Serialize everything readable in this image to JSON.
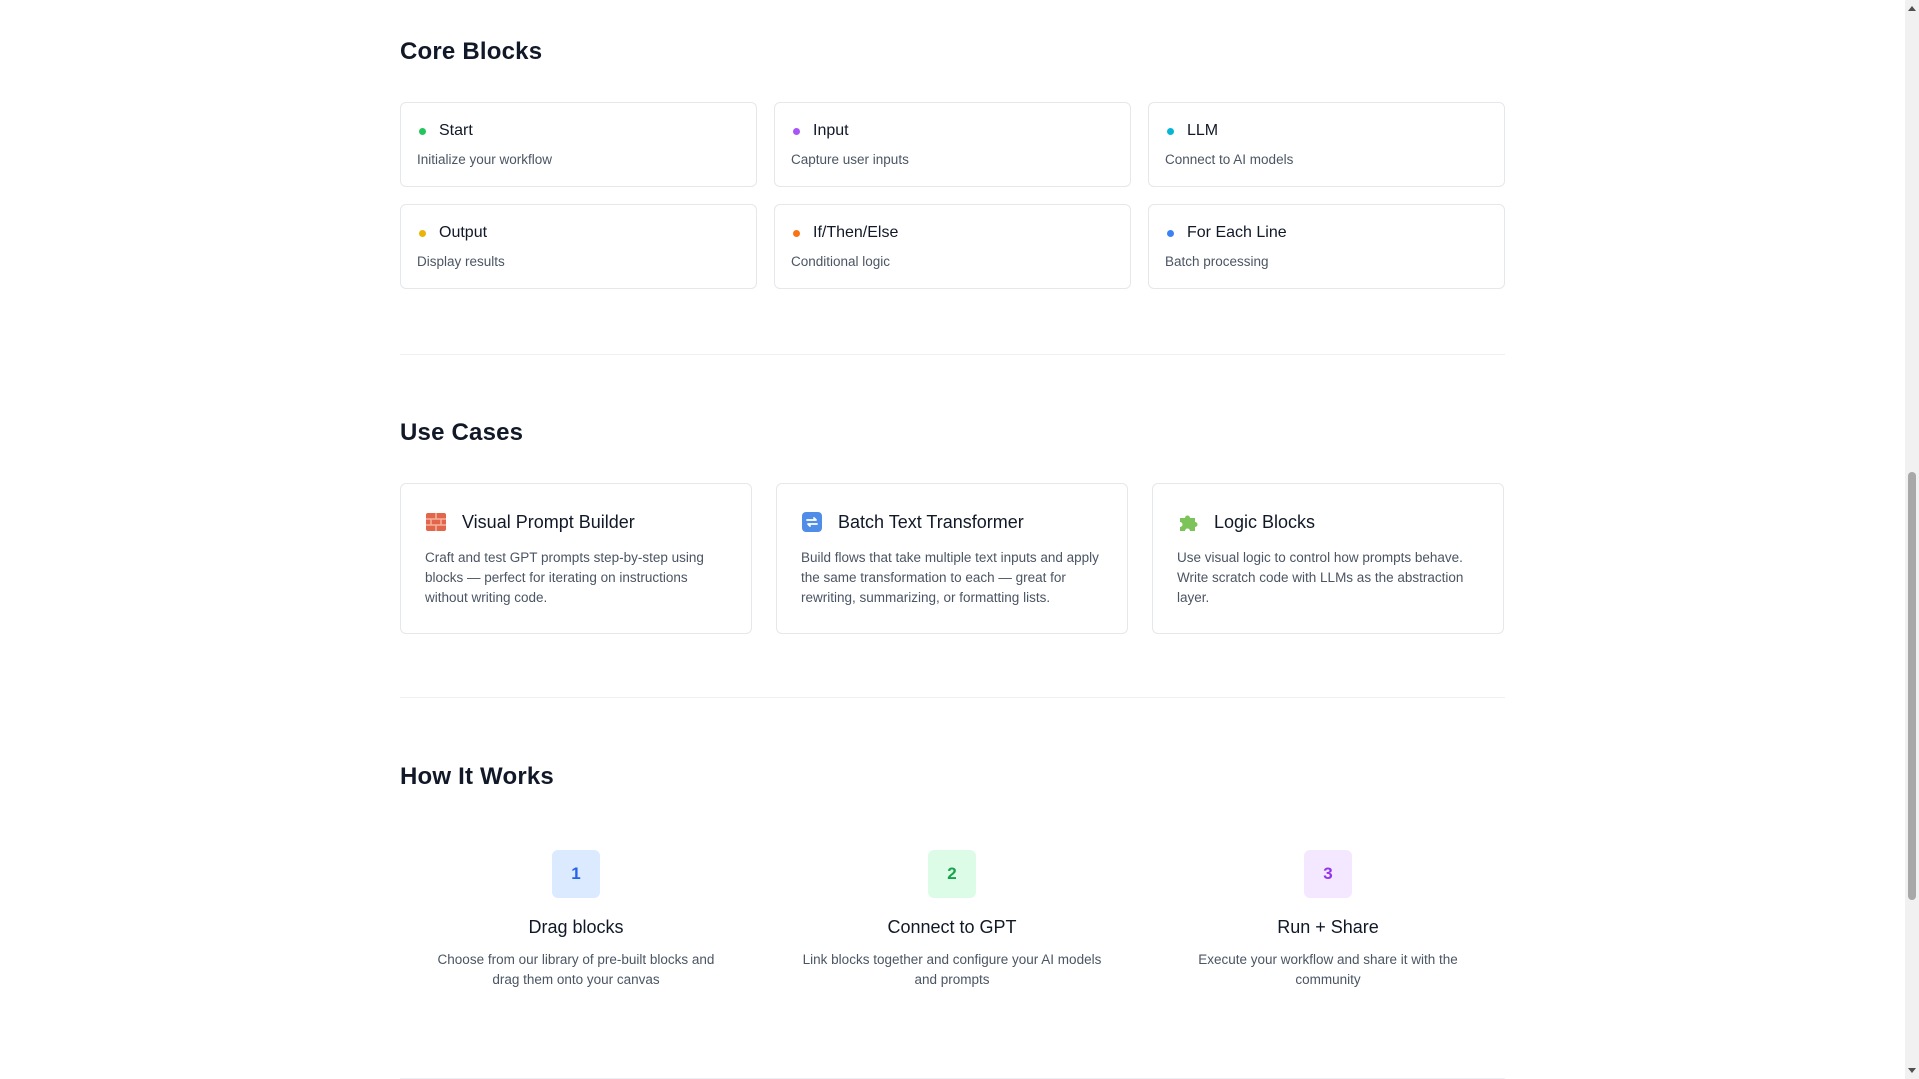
{
  "core": {
    "title": "Core Blocks",
    "blocks": [
      {
        "name": "Start",
        "desc": "Initialize your workflow",
        "color": "#22c55e"
      },
      {
        "name": "Input",
        "desc": "Capture user inputs",
        "color": "#a855f7"
      },
      {
        "name": "LLM",
        "desc": "Connect to AI models",
        "color": "#06b6d4"
      },
      {
        "name": "Output",
        "desc": "Display results",
        "color": "#eab308"
      },
      {
        "name": "If/Then/Else",
        "desc": "Conditional logic",
        "color": "#f97316"
      },
      {
        "name": "For Each Line",
        "desc": "Batch processing",
        "color": "#3b82f6"
      }
    ]
  },
  "use_cases": {
    "title": "Use Cases",
    "items": [
      {
        "icon": "brick-icon",
        "name": "Visual Prompt Builder",
        "desc": "Craft and test GPT prompts step-by-step using blocks — perfect for iterating on instructions without writing code."
      },
      {
        "icon": "repeat-icon",
        "name": "Batch Text Transformer",
        "desc": "Build flows that take multiple text inputs and apply the same transformation to each — great for rewriting, summarizing, or formatting lists."
      },
      {
        "icon": "puzzle-icon",
        "name": "Logic Blocks",
        "desc": "Use visual logic to control how prompts behave. Write scratch code with LLMs as the abstraction layer."
      }
    ]
  },
  "how": {
    "title": "How It Works",
    "steps": [
      {
        "num": "1",
        "title": "Drag blocks",
        "desc": "Choose from our library of pre-built blocks and drag them onto your canvas",
        "bg": "#dbeafe",
        "fg": "#2563eb"
      },
      {
        "num": "2",
        "title": "Connect to GPT",
        "desc": "Link blocks together and configure your AI models and prompts",
        "bg": "#dcfce7",
        "fg": "#16a34a"
      },
      {
        "num": "3",
        "title": "Run + Share",
        "desc": "Execute your workflow and share it with the community",
        "bg": "#f3e8ff",
        "fg": "#9333ea"
      }
    ]
  }
}
